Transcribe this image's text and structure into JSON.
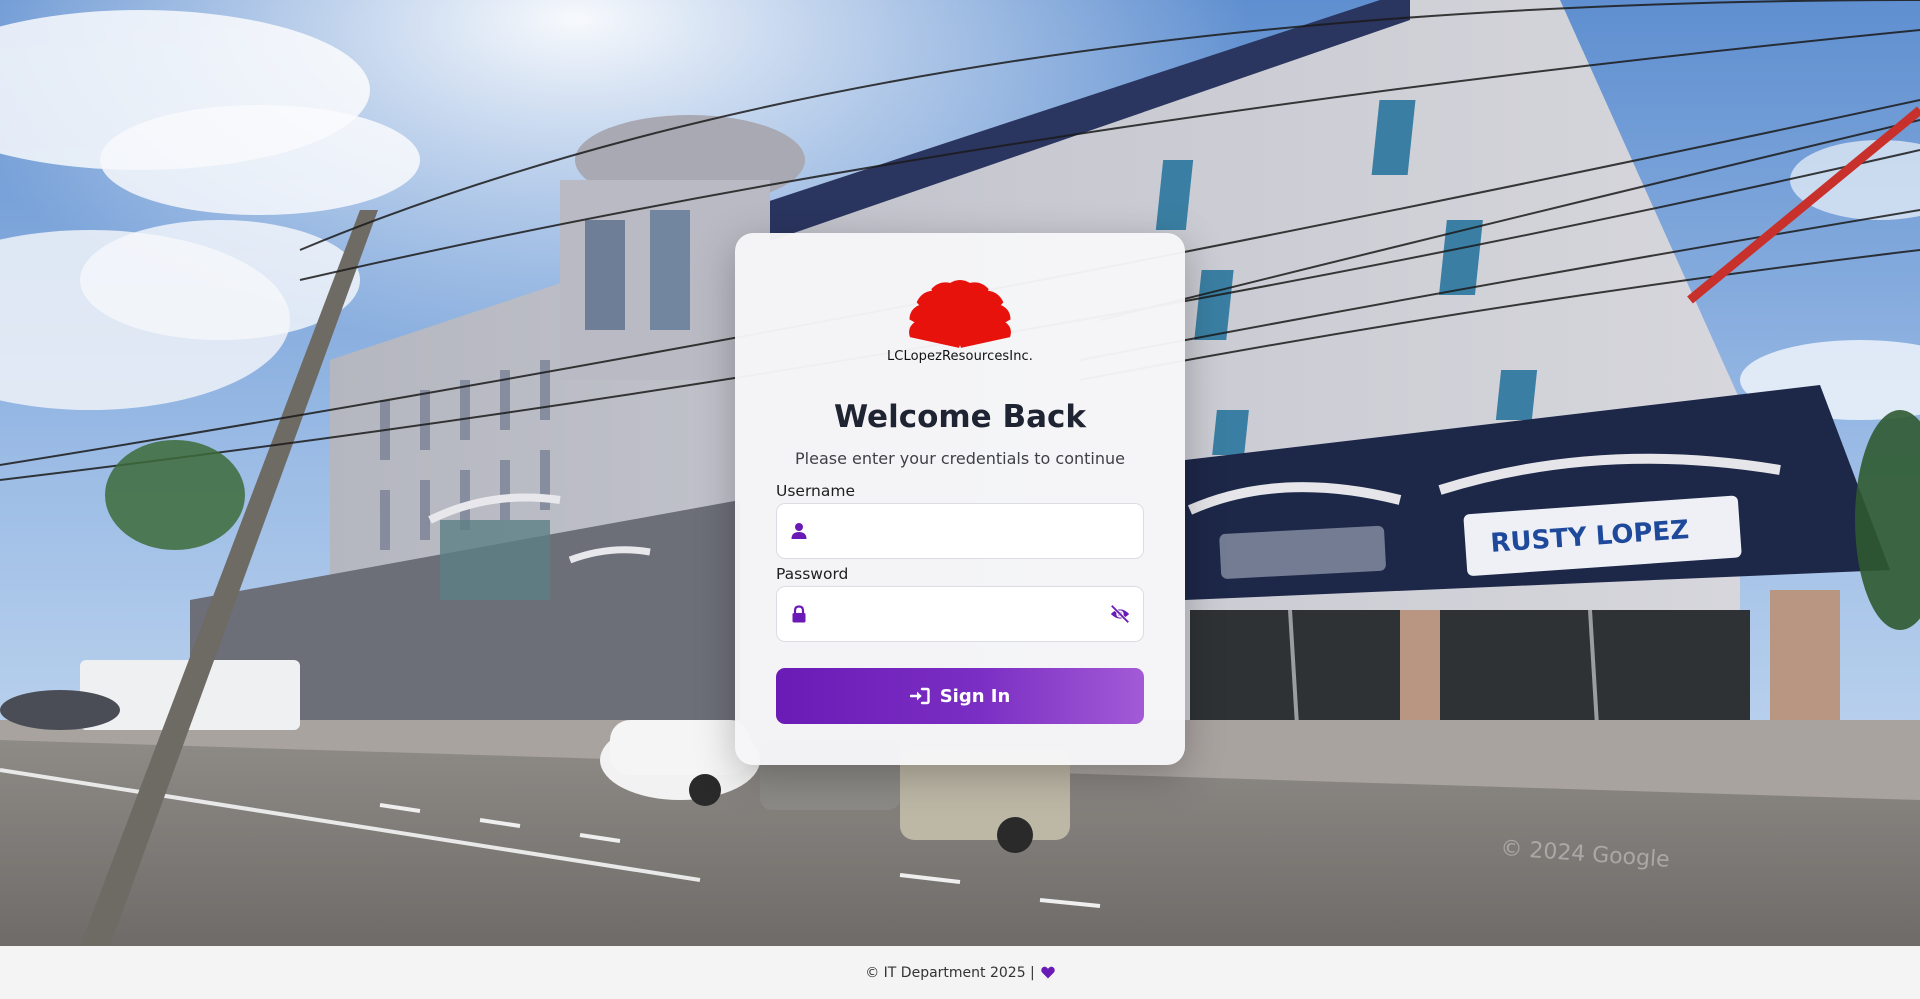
{
  "background": {
    "description_icon": "building-photo",
    "storefront_sign": "RUSTY LOPEZ",
    "watermark": "© 2024 Google"
  },
  "brand": {
    "logo_icon": "sunburst-logo-icon",
    "name": "LCLopezResourcesInc.",
    "logo_color": "#e8120c"
  },
  "login": {
    "title": "Welcome Back",
    "subtitle": "Please enter your credentials to continue",
    "username": {
      "label": "Username",
      "value": "",
      "placeholder": "",
      "icon": "user-icon"
    },
    "password": {
      "label": "Password",
      "value": "",
      "placeholder": "",
      "icon": "lock-icon",
      "toggle_icon": "eye-slash-icon"
    },
    "submit": {
      "label": "Sign In",
      "icon": "sign-in-icon"
    }
  },
  "footer": {
    "text": "© IT Department 2025 |",
    "icon": "heart-icon"
  },
  "colors": {
    "accent": "#6a1bb6",
    "accent_light": "#a35ad6",
    "title": "#1f2433"
  }
}
